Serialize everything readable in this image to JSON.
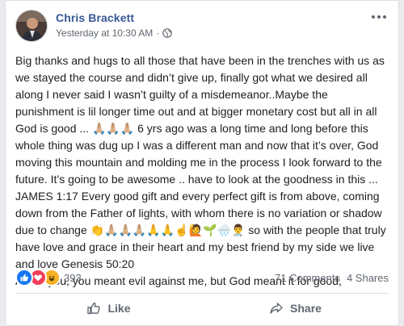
{
  "post": {
    "author": "Chris Brackett",
    "timestamp": "Yesterday at 10:30 AM",
    "separator": "·",
    "privacy_icon": "globe-icon",
    "more_icon": "more-options-icon",
    "body": [
      "Big thanks and hugs to all those that have been in the trenches with us as we stayed the course and didn’t give up, finally got what we desired all along I never said I wasn’t guilty of a misdemeanor..Maybe the punishment is lil longer time out and at bigger monetary cost but all in all God is good ... 🙏🏼🙏🏼🙏🏼 6 yrs ago was a long time and long before this whole thing was dug up I was a different man and now that it’s over, God moving this mountain and molding me in the process I look forward to the future. It’s going to be awesome .. have to look at the goodness in this ... JAMES 1:17 Every good gift and every perfect gift is from above, coming down from the Father of lights, with whom there is no variation or shadow due to change 👏🙏🏼🙏🏼🙏🏼🙏🙏☝️🙋🌱🌧️👨‍⚕️ so with the people that truly have love and grace in their heart and my best friend by my side we live and love Genesis 50:20",
      "As for you, you meant evil against me, but God meant it for good,"
    ]
  },
  "stats": {
    "reaction_icons": [
      "like-reaction-icon",
      "love-reaction-icon",
      "haha-reaction-icon"
    ],
    "reaction_count": "393",
    "comments": "71 Comments",
    "shares": "4 Shares"
  },
  "actions": {
    "like_label": "Like",
    "share_label": "Share"
  },
  "colors": {
    "name_link": "#385898",
    "secondary_text": "#606770",
    "like_blue": "#1877f2",
    "love_red": "#f33e58",
    "haha_yellow": "#f7b125"
  }
}
